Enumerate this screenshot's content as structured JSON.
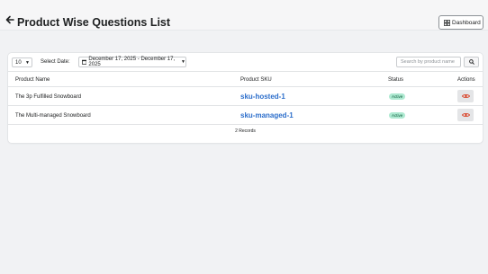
{
  "header": {
    "title": "Product Wise Questions List",
    "dashboard_label": "Dashboard"
  },
  "filters": {
    "per_page": "10",
    "select_date_label": "Select Date:",
    "date_range": "December 17, 2025 - December 17, 2025",
    "search_placeholder": "Search by product name"
  },
  "table": {
    "columns": [
      "Product Name",
      "Product SKU",
      "Status",
      "Actions"
    ],
    "rows": [
      {
        "name": "The 3p Fulfilled Snowboard",
        "sku": "sku-hosted-1",
        "status": "Active"
      },
      {
        "name": "The Multi-managed Snowboard",
        "sku": "sku-managed-1",
        "status": "Active"
      }
    ],
    "records": "2 Records"
  },
  "colors": {
    "link": "#2c6ecb",
    "badge_bg": "#aee9d1",
    "eye_icon": "#d82c0d"
  },
  "icons": [
    "back-arrow-icon",
    "dashboard-grid-icon",
    "chevron-down-icon",
    "calendar-icon",
    "search-icon",
    "eye-icon"
  ]
}
